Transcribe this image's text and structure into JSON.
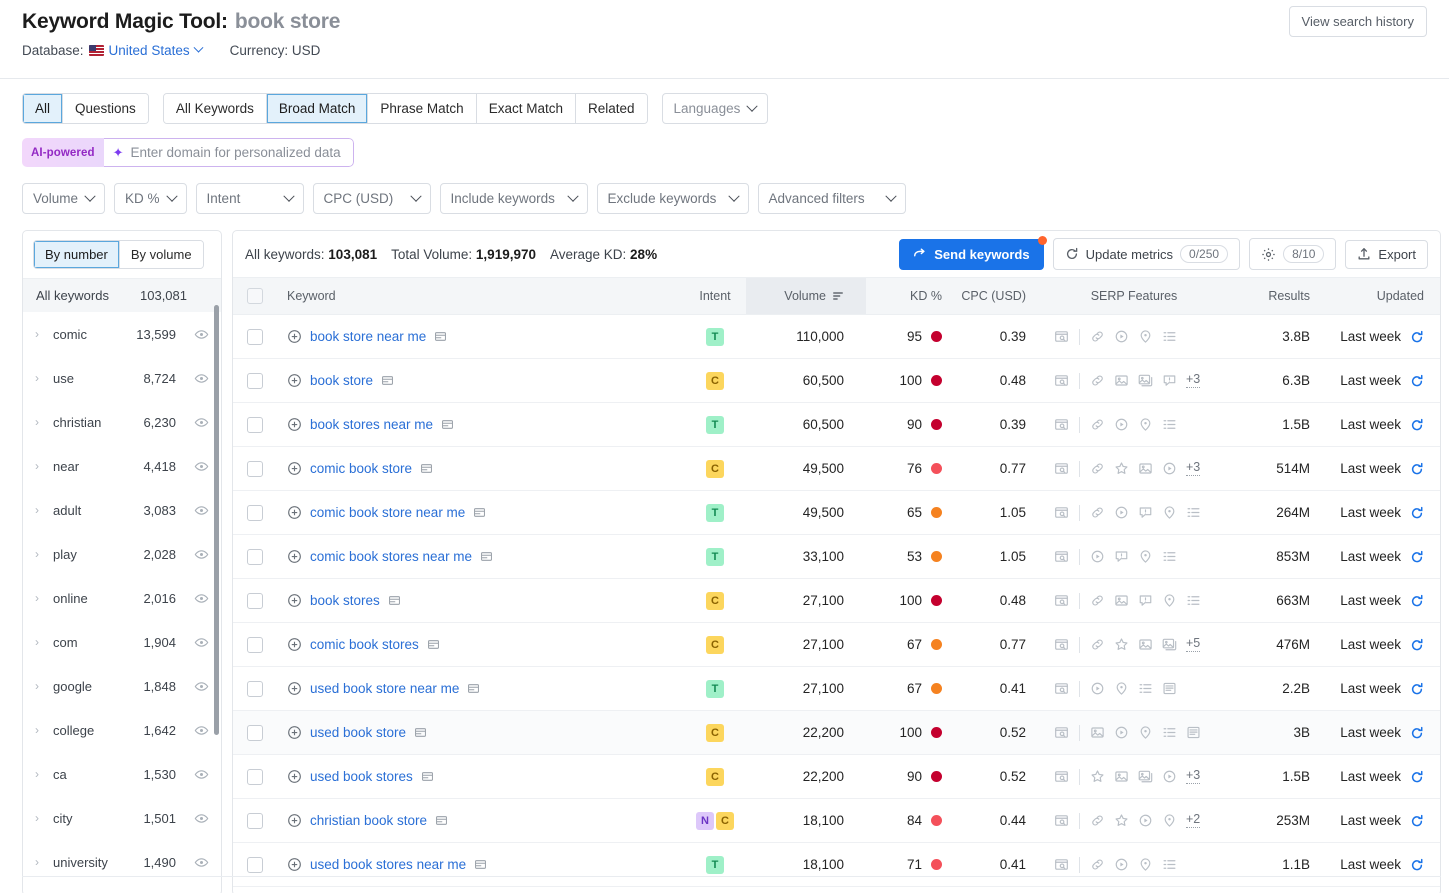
{
  "header": {
    "title_main": "Keyword Magic Tool:",
    "title_query": "book store",
    "database_label": "Database:",
    "database_value": "United States",
    "currency_label": "Currency: USD",
    "search_history_button": "View search history"
  },
  "filters": {
    "match_tabs_1": [
      {
        "label": "All",
        "active": true
      },
      {
        "label": "Questions",
        "active": false
      }
    ],
    "match_tabs_2": [
      {
        "label": "All Keywords",
        "active": false
      },
      {
        "label": "Broad Match",
        "active": true
      },
      {
        "label": "Phrase Match",
        "active": false
      },
      {
        "label": "Exact Match",
        "active": false
      },
      {
        "label": "Related",
        "active": false
      }
    ],
    "languages_label": "Languages",
    "ai_badge": "AI-powered",
    "ai_placeholder": "Enter domain for personalized data",
    "dropdowns": [
      "Volume",
      "KD %",
      "Intent",
      "CPC (USD)",
      "Include keywords",
      "Exclude keywords",
      "Advanced filters"
    ]
  },
  "sidebar": {
    "toggle": [
      {
        "label": "By number",
        "active": true
      },
      {
        "label": "By volume",
        "active": false
      }
    ],
    "all_keywords_label": "All keywords",
    "all_keywords_count": "103,081",
    "groups": [
      {
        "label": "comic",
        "count": "13,599"
      },
      {
        "label": "use",
        "count": "8,724"
      },
      {
        "label": "christian",
        "count": "6,230"
      },
      {
        "label": "near",
        "count": "4,418"
      },
      {
        "label": "adult",
        "count": "3,083"
      },
      {
        "label": "play",
        "count": "2,028"
      },
      {
        "label": "online",
        "count": "2,016"
      },
      {
        "label": "com",
        "count": "1,904"
      },
      {
        "label": "google",
        "count": "1,848"
      },
      {
        "label": "college",
        "count": "1,642"
      },
      {
        "label": "ca",
        "count": "1,530"
      },
      {
        "label": "city",
        "count": "1,501"
      },
      {
        "label": "university",
        "count": "1,490"
      }
    ]
  },
  "panel": {
    "summary": {
      "all_keywords_label": "All keywords:",
      "all_keywords_value": "103,081",
      "total_volume_label": "Total Volume:",
      "total_volume_value": "1,919,970",
      "average_kd_label": "Average KD:",
      "average_kd_value": "28%"
    },
    "actions": {
      "send_keywords": "Send keywords",
      "update_metrics": "Update metrics",
      "update_metrics_count": "0/250",
      "settings_count": "8/10",
      "export": "Export"
    },
    "columns": {
      "keyword": "Keyword",
      "intent": "Intent",
      "volume": "Volume",
      "kd": "KD %",
      "cpc": "CPC (USD)",
      "serp": "SERP Features",
      "results": "Results",
      "updated": "Updated"
    },
    "rows": [
      {
        "keyword": "book store near me",
        "intent": [
          "T"
        ],
        "volume": "110,000",
        "kd": "95",
        "kd_color": "#c4002e",
        "cpc": "0.39",
        "serp": [
          "serp-preview",
          "link",
          "video",
          "local",
          "list"
        ],
        "serp_more": "",
        "results": "3.8B",
        "updated": "Last week"
      },
      {
        "keyword": "book store",
        "intent": [
          "C"
        ],
        "volume": "60,500",
        "kd": "100",
        "kd_color": "#c4002e",
        "cpc": "0.48",
        "serp": [
          "serp-preview",
          "link",
          "image",
          "images",
          "discussion"
        ],
        "serp_more": "+3",
        "results": "6.3B",
        "updated": "Last week"
      },
      {
        "keyword": "book stores near me",
        "intent": [
          "T"
        ],
        "volume": "60,500",
        "kd": "90",
        "kd_color": "#c4002e",
        "cpc": "0.39",
        "serp": [
          "serp-preview",
          "link",
          "video",
          "local",
          "list"
        ],
        "serp_more": "",
        "results": "1.5B",
        "updated": "Last week"
      },
      {
        "keyword": "comic book store",
        "intent": [
          "C"
        ],
        "volume": "49,500",
        "kd": "76",
        "kd_color": "#f4505a",
        "cpc": "0.77",
        "serp": [
          "serp-preview",
          "link",
          "reviews",
          "image",
          "video"
        ],
        "serp_more": "+3",
        "results": "514M",
        "updated": "Last week"
      },
      {
        "keyword": "comic book store near me",
        "intent": [
          "T"
        ],
        "volume": "49,500",
        "kd": "65",
        "kd_color": "#f58220",
        "cpc": "1.05",
        "serp": [
          "serp-preview",
          "link",
          "video",
          "discussion",
          "local",
          "list"
        ],
        "serp_more": "",
        "results": "264M",
        "updated": "Last week"
      },
      {
        "keyword": "comic book stores near me",
        "intent": [
          "T"
        ],
        "volume": "33,100",
        "kd": "53",
        "kd_color": "#f58220",
        "cpc": "1.05",
        "serp": [
          "serp-preview",
          "video",
          "discussion",
          "local",
          "list"
        ],
        "serp_more": "",
        "results": "853M",
        "updated": "Last week"
      },
      {
        "keyword": "book stores",
        "intent": [
          "C"
        ],
        "volume": "27,100",
        "kd": "100",
        "kd_color": "#c4002e",
        "cpc": "0.48",
        "serp": [
          "serp-preview",
          "link",
          "image",
          "discussion",
          "local",
          "list"
        ],
        "serp_more": "",
        "results": "663M",
        "updated": "Last week"
      },
      {
        "keyword": "comic book stores",
        "intent": [
          "C"
        ],
        "volume": "27,100",
        "kd": "67",
        "kd_color": "#f58220",
        "cpc": "0.77",
        "serp": [
          "serp-preview",
          "link",
          "reviews",
          "image",
          "images"
        ],
        "serp_more": "+5",
        "results": "476M",
        "updated": "Last week"
      },
      {
        "keyword": "used book store near me",
        "intent": [
          "T"
        ],
        "volume": "27,100",
        "kd": "67",
        "kd_color": "#f58220",
        "cpc": "0.41",
        "serp": [
          "serp-preview",
          "video",
          "local",
          "list",
          "article"
        ],
        "serp_more": "",
        "results": "2.2B",
        "updated": "Last week"
      },
      {
        "keyword": "used book store",
        "intent": [
          "C"
        ],
        "volume": "22,200",
        "kd": "100",
        "kd_color": "#c4002e",
        "cpc": "0.52",
        "serp": [
          "serp-preview",
          "image",
          "video",
          "local",
          "list",
          "article"
        ],
        "serp_more": "",
        "results": "3B",
        "updated": "Last week"
      },
      {
        "keyword": "used book stores",
        "intent": [
          "C"
        ],
        "volume": "22,200",
        "kd": "90",
        "kd_color": "#c4002e",
        "cpc": "0.52",
        "serp": [
          "serp-preview",
          "reviews",
          "image",
          "images",
          "video"
        ],
        "serp_more": "+3",
        "results": "1.5B",
        "updated": "Last week"
      },
      {
        "keyword": "christian book store",
        "intent": [
          "N",
          "C"
        ],
        "volume": "18,100",
        "kd": "84",
        "kd_color": "#f4505a",
        "cpc": "0.44",
        "serp": [
          "serp-preview",
          "link",
          "reviews",
          "video",
          "local"
        ],
        "serp_more": "+2",
        "results": "253M",
        "updated": "Last week"
      },
      {
        "keyword": "used book stores near me",
        "intent": [
          "T"
        ],
        "volume": "18,100",
        "kd": "71",
        "kd_color": "#f4505a",
        "cpc": "0.41",
        "serp": [
          "serp-preview",
          "link",
          "video",
          "local",
          "list"
        ],
        "serp_more": "",
        "results": "1.1B",
        "updated": "Last week"
      }
    ]
  },
  "colors": {
    "accent_blue": "#1a73e8",
    "link_blue": "#2a6fd6",
    "kd_high": "#c4002e",
    "kd_mid": "#f4505a",
    "kd_low": "#f58220",
    "intent_t": "#9ff0c8",
    "intent_c": "#fcd65d",
    "intent_n": "#ddc8fa"
  }
}
